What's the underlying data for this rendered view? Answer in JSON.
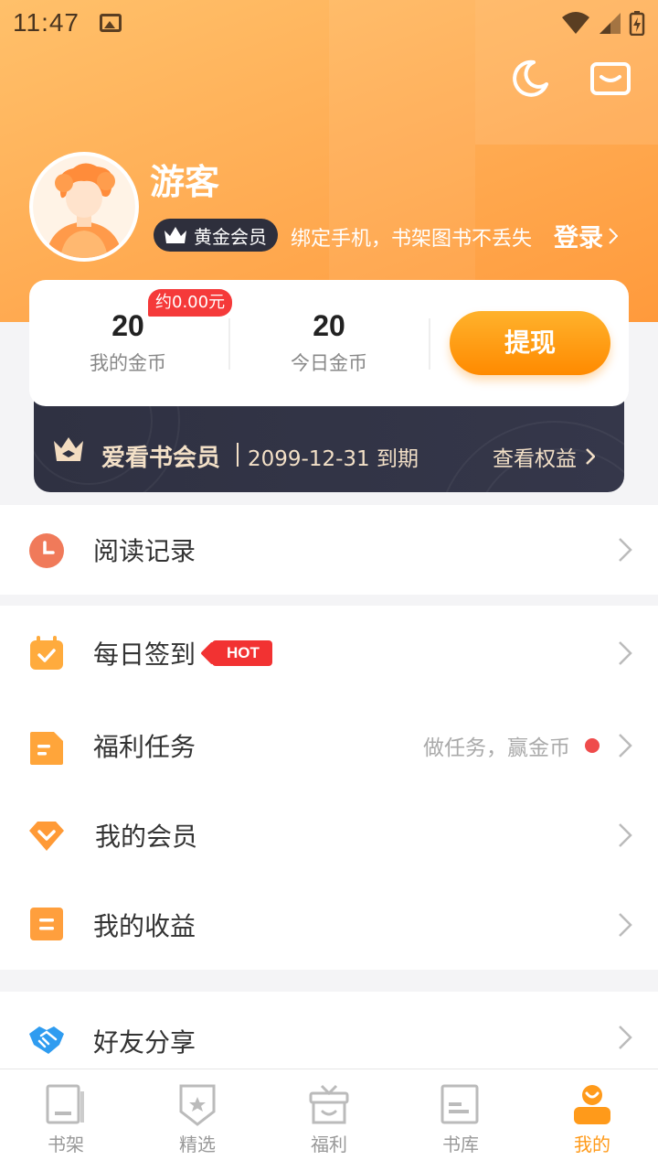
{
  "status_bar": {
    "time": "11:47"
  },
  "profile": {
    "username": "游客",
    "vip_badge": "黄金会员",
    "bind_tip": "绑定手机，书架图书不丢失",
    "login_label": "登录"
  },
  "coins": {
    "approx_value": "约0.00元",
    "my_coins_value": "20",
    "my_coins_label": "我的金币",
    "today_coins_value": "20",
    "today_coins_label": "今日金币",
    "withdraw_label": "提现"
  },
  "member": {
    "title": "爱看书会员",
    "expire": "2099-12-31 到期",
    "link": "查看权益"
  },
  "menu": {
    "reading_history": "阅读记录",
    "daily_checkin": "每日签到",
    "hot_tag": "HOT",
    "welfare_tasks": "福利任务",
    "welfare_hint": "做任务，赢金币",
    "my_membership": "我的会员",
    "my_earnings": "我的收益",
    "share_friends": "好友分享"
  },
  "bottom_nav": {
    "items": [
      {
        "label": "书架",
        "icon": "bookshelf-icon"
      },
      {
        "label": "精选",
        "icon": "featured-icon"
      },
      {
        "label": "福利",
        "icon": "gift-icon"
      },
      {
        "label": "书库",
        "icon": "library-icon"
      },
      {
        "label": "我的",
        "icon": "profile-icon"
      }
    ],
    "active_index": 4
  },
  "colors": {
    "accent": "#ff9a1a",
    "header_gradient_start": "#ffc06a",
    "header_gradient_end": "#ff9a3c",
    "hot_red": "#f23232",
    "member_dark": "#2f3142"
  }
}
